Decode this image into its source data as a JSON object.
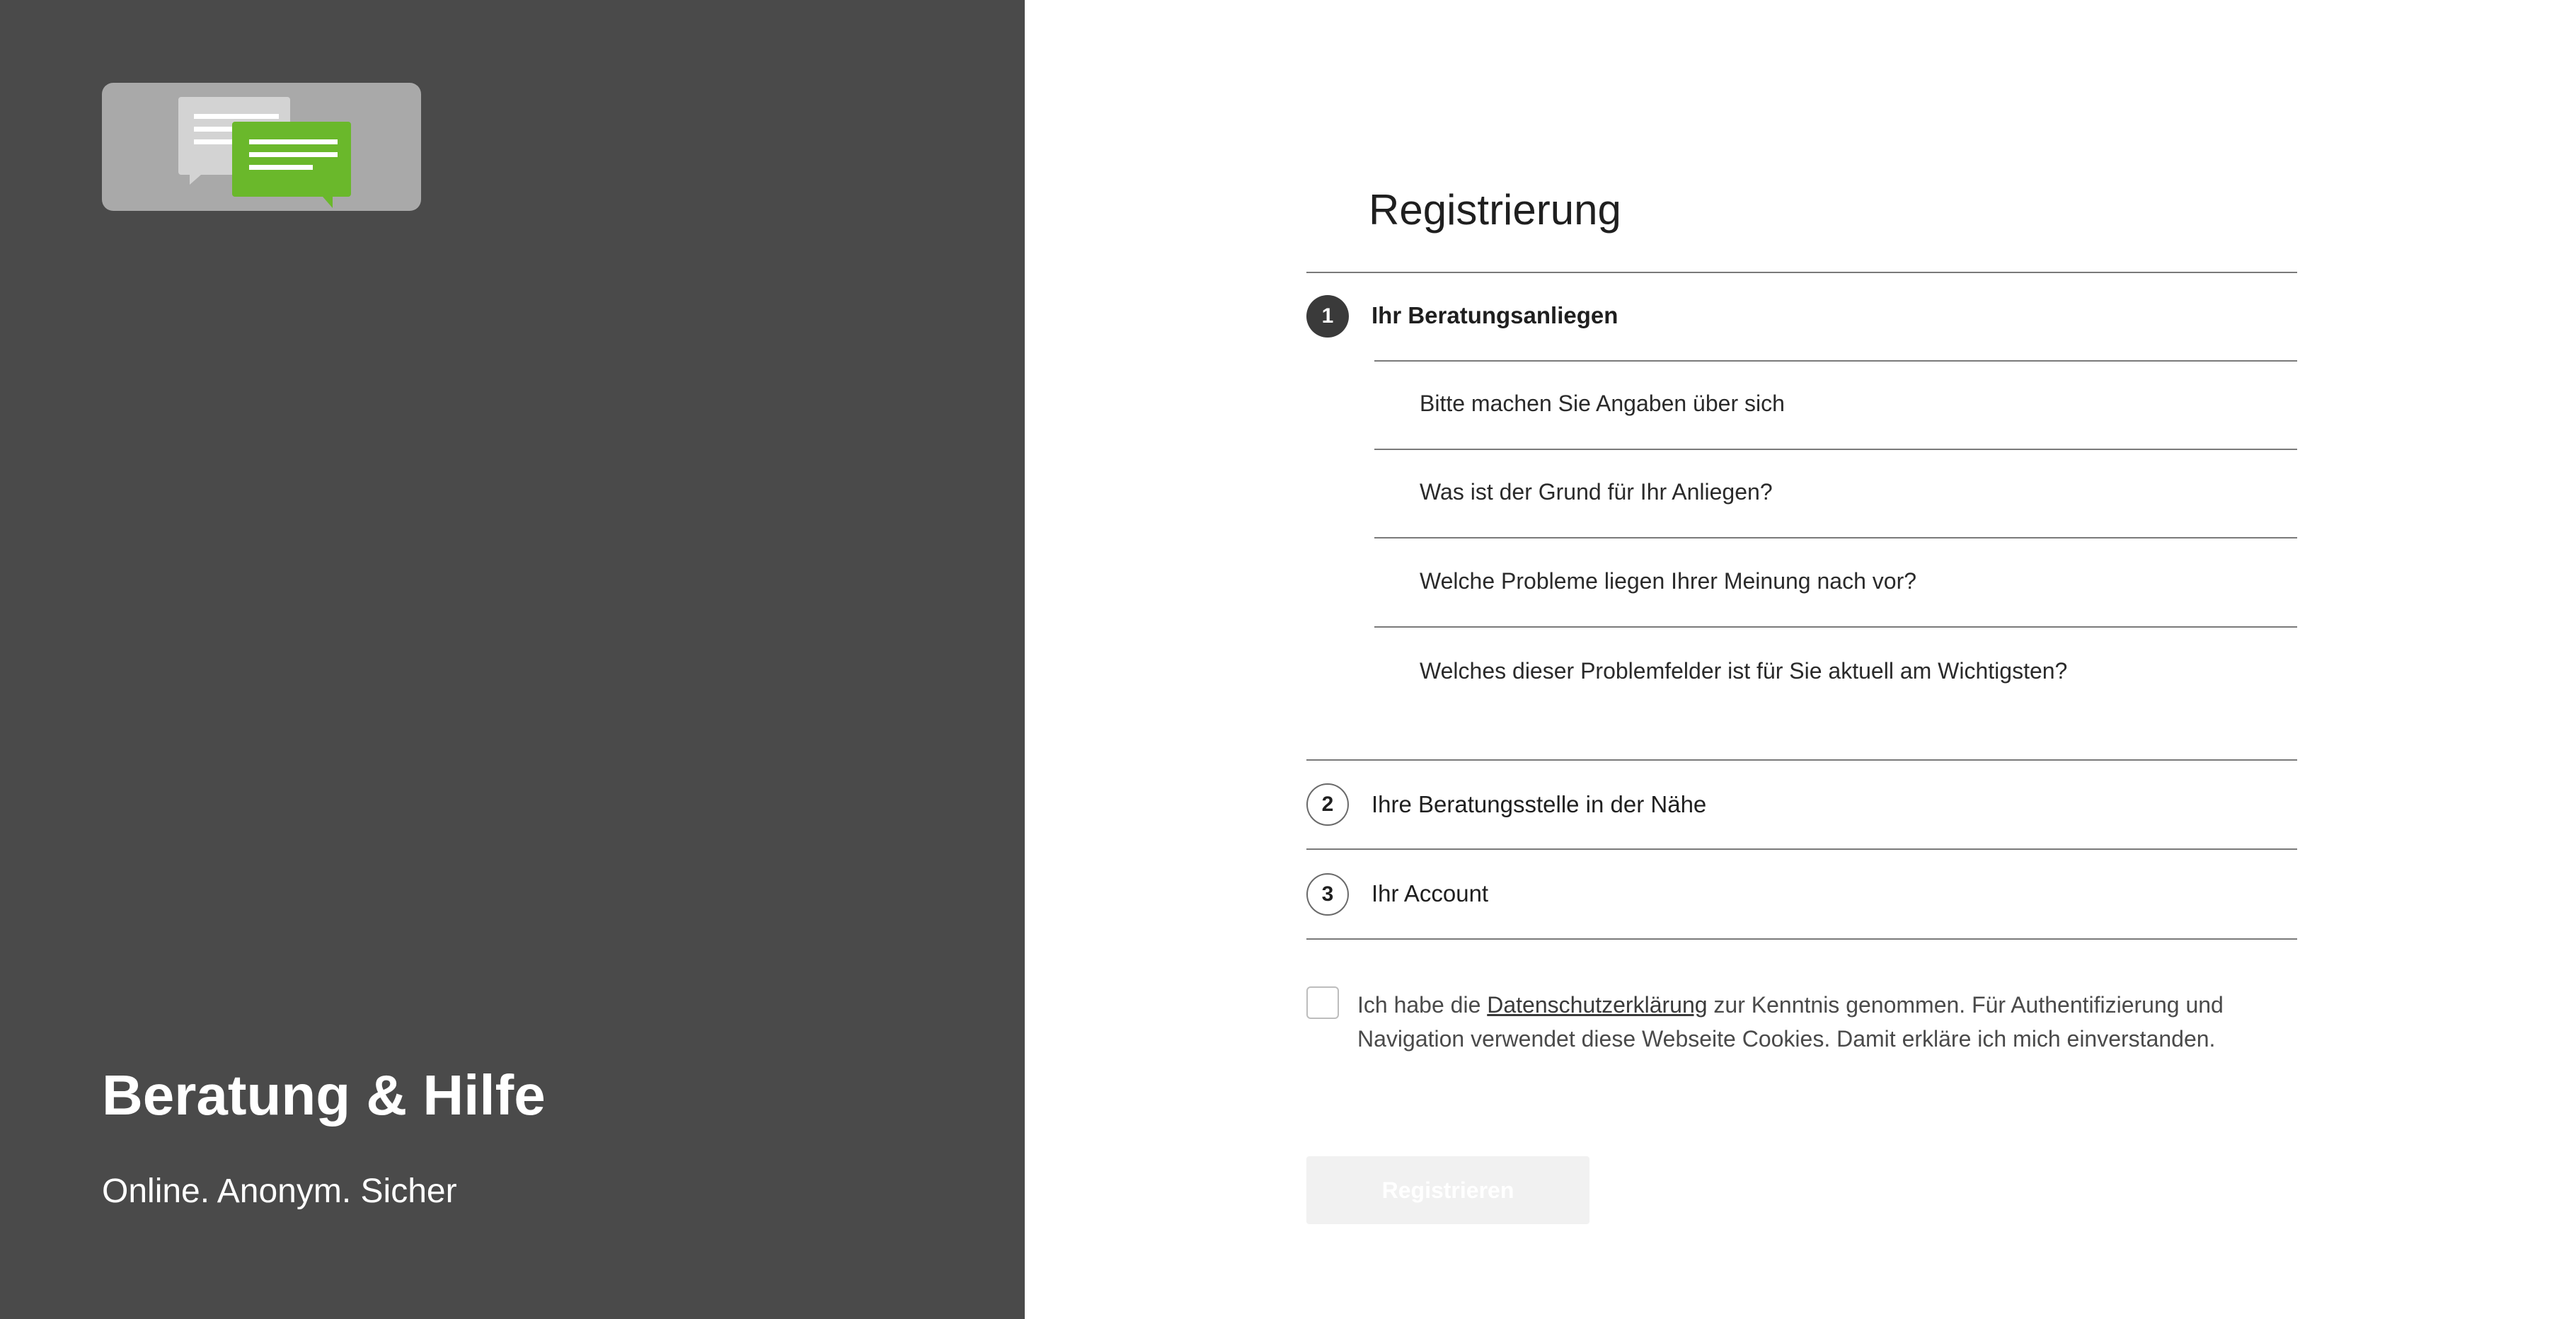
{
  "brand": {
    "title": "Beratung & Hilfe",
    "subtitle": "Online. Anonym. Sicher",
    "logo_icon": "chat-bubbles-icon",
    "colors": {
      "panel": "#4a4a4a",
      "logo_bg": "#a9a9a9",
      "bubble_back": "#d3d3d3",
      "bubble_front": "#6ab82b"
    }
  },
  "form": {
    "title": "Registrierung",
    "steps": [
      {
        "number": "1",
        "label": "Ihr Beratungsanliegen",
        "state": "active",
        "items": [
          "Bitte machen Sie Angaben über sich",
          "Was ist der Grund für Ihr Anliegen?",
          "Welche Probleme liegen Ihrer Meinung nach vor?",
          "Welches dieser Problemfelder ist für Sie aktuell am Wichtigsten?"
        ]
      },
      {
        "number": "2",
        "label": "Ihre Beratungsstelle in der Nähe",
        "state": "inactive"
      },
      {
        "number": "3",
        "label": "Ihr Account",
        "state": "inactive"
      }
    ],
    "consent": {
      "before": "Ich habe die ",
      "link": "Datenschutzerklärung",
      "after": " zur Kenntnis genommen. Für Authentifizierung und Navigation verwendet diese Webseite Cookies. Damit erkläre ich mich einverstanden.",
      "checked": false
    },
    "submit_label": "Registrieren"
  }
}
